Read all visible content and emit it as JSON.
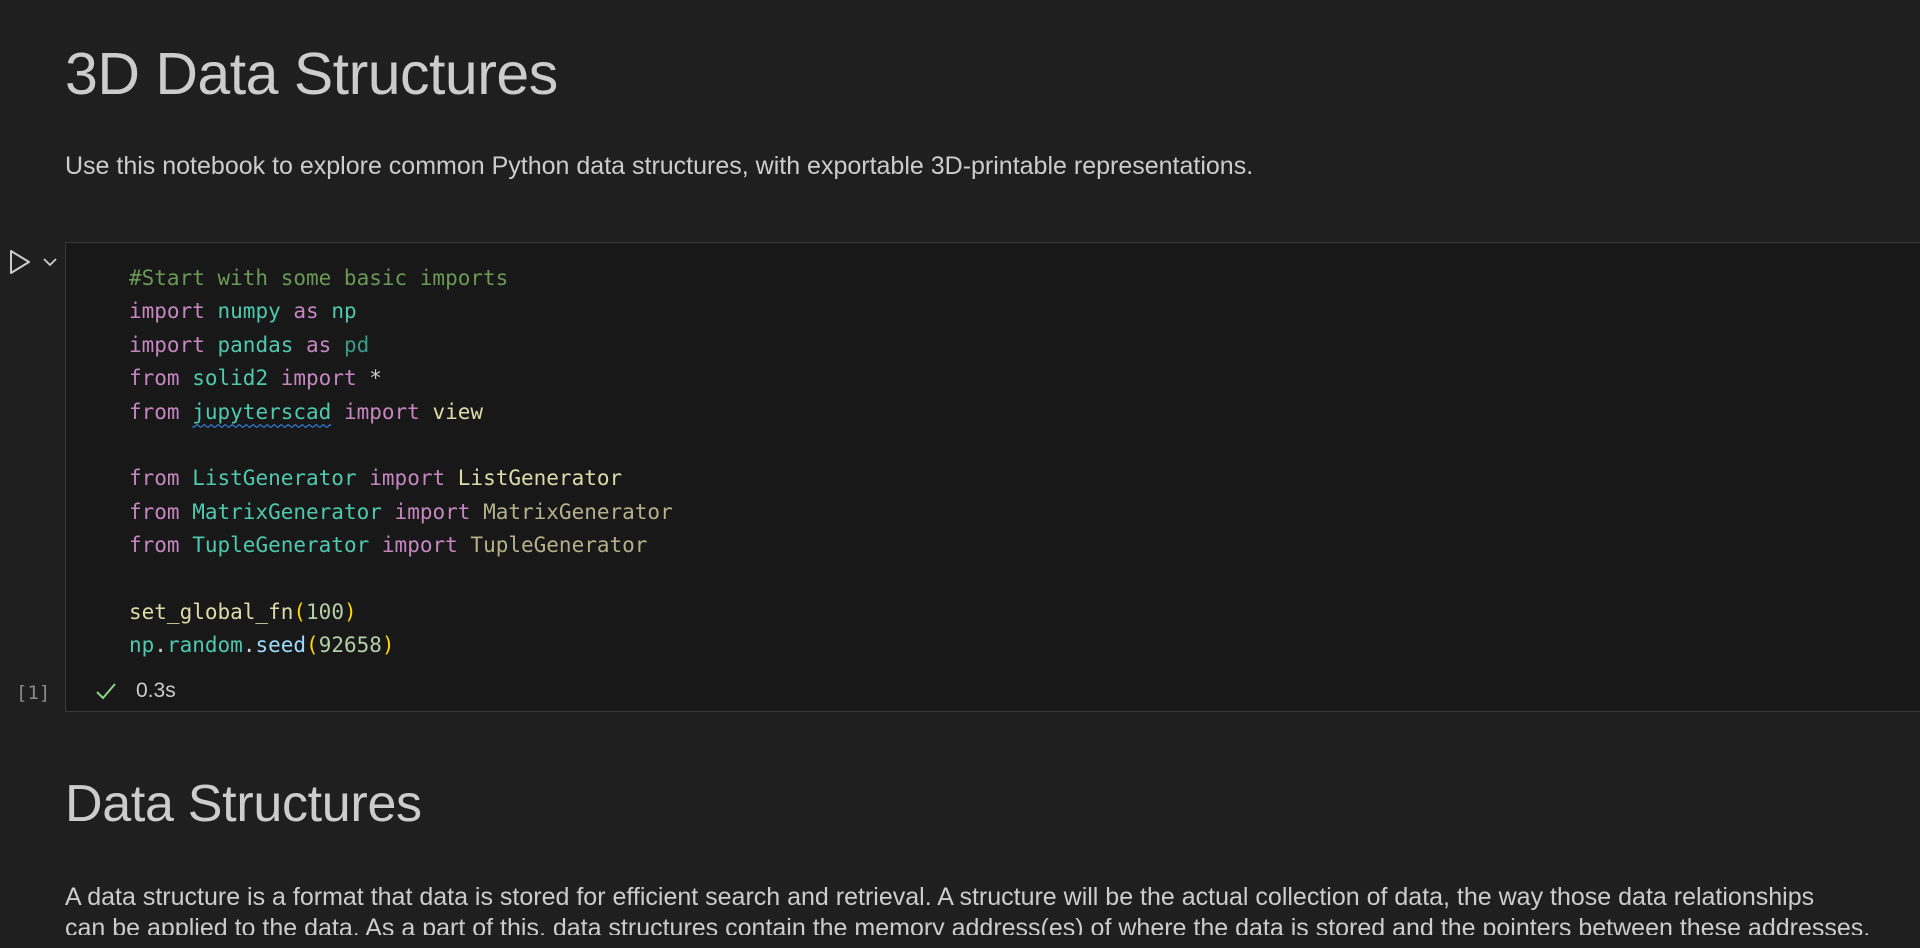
{
  "notebook": {
    "title": "3D Data Structures",
    "intro": "Use this notebook to explore common Python data structures, with exportable 3D-printable representations."
  },
  "cell1": {
    "execution_count": "[1]",
    "duration": "0.3s",
    "status": "success",
    "code": {
      "comment": "#Start with some basic imports",
      "l2": {
        "kw1": "import",
        "mod": "numpy",
        "kw2": "as",
        "alias": "np"
      },
      "l3": {
        "kw1": "import",
        "mod": "pandas",
        "kw2": "as",
        "alias": "pd"
      },
      "l4": {
        "kw1": "from",
        "mod": "solid2",
        "kw2": "import",
        "name": "*"
      },
      "l5": {
        "kw1": "from",
        "mod": "jupyterscad",
        "kw2": "import",
        "name": "view"
      },
      "l6": {
        "kw1": "from",
        "mod": "ListGenerator",
        "kw2": "import",
        "name": "ListGenerator"
      },
      "l7": {
        "kw1": "from",
        "mod": "MatrixGenerator",
        "kw2": "import",
        "name": "MatrixGenerator"
      },
      "l8": {
        "kw1": "from",
        "mod": "TupleGenerator",
        "kw2": "import",
        "name": "TupleGenerator"
      },
      "l9": {
        "fn": "set_global_fn",
        "open": "(",
        "arg": "100",
        "close": ")"
      },
      "l10": {
        "obj": "np",
        "dot1": ".",
        "attr": "random",
        "dot2": ".",
        "fn": "seed",
        "open": "(",
        "arg": "92658",
        "close": ")"
      }
    }
  },
  "section": {
    "heading": "Data Structures",
    "paragraph_line1": "A data structure is a format that data is stored for efficient search and retrieval. A structure will be the actual collection of data, the way those data relationships",
    "paragraph_line2": "can be applied to the data. As a part of this, data structures contain the memory address(es) of where the data is stored and the pointers between these addresses."
  },
  "icons": {
    "run": "play-icon",
    "run_menu": "chevron-down-icon",
    "status": "check-icon"
  },
  "colors": {
    "background": "#1f1f1f",
    "cell_background": "#181818",
    "keyword": "#c586c0",
    "module": "#4ec9b0",
    "comment": "#6a9955",
    "function": "#dcdcaa",
    "number": "#b5cea8",
    "success": "#89d185"
  }
}
